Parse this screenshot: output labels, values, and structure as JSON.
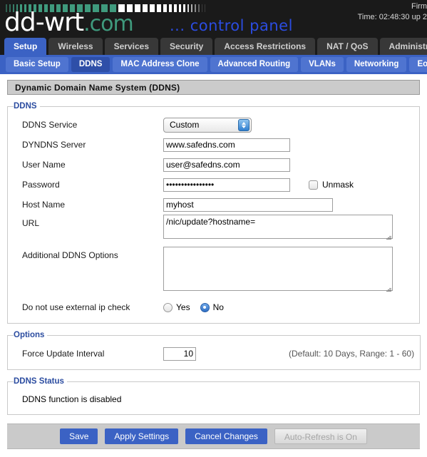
{
  "header": {
    "logo_main": "dd-wrt",
    "logo_suffix": ".com",
    "tagline": "... control panel",
    "firmware_line": "Firm",
    "time_line": "Time: 02:48:30 up 2",
    "barcode_colors": [
      "#3f9a7d",
      "#ffffff"
    ]
  },
  "nav": {
    "tabs": [
      {
        "label": "Setup",
        "active": true
      },
      {
        "label": "Wireless",
        "active": false
      },
      {
        "label": "Services",
        "active": false
      },
      {
        "label": "Security",
        "active": false
      },
      {
        "label": "Access Restrictions",
        "active": false
      },
      {
        "label": "NAT / QoS",
        "active": false
      },
      {
        "label": "Administration",
        "active": false
      }
    ],
    "subtabs": [
      {
        "label": "Basic Setup",
        "active": false
      },
      {
        "label": "DDNS",
        "active": true
      },
      {
        "label": "MAC Address Clone",
        "active": false
      },
      {
        "label": "Advanced Routing",
        "active": false
      },
      {
        "label": "VLANs",
        "active": false
      },
      {
        "label": "Networking",
        "active": false
      },
      {
        "label": "EoI",
        "active": false
      }
    ]
  },
  "page": {
    "title": "Dynamic Domain Name System (DDNS)"
  },
  "ddns": {
    "legend": "DDNS",
    "service_label": "DDNS Service",
    "service_value": "Custom",
    "server_label": "DYNDNS Server",
    "server_value": "www.safedns.com",
    "username_label": "User Name",
    "username_value": "user@safedns.com",
    "password_label": "Password",
    "password_value": "••••••••••••••••",
    "unmask_label": "Unmask",
    "unmask_checked": false,
    "hostname_label": "Host Name",
    "hostname_value": "myhost",
    "url_label": "URL",
    "url_value": "/nic/update?hostname=",
    "additional_label": "Additional DDNS Options",
    "additional_value": "",
    "external_ip_label": "Do not use external ip check",
    "external_ip_yes": "Yes",
    "external_ip_no": "No",
    "external_ip_selected": "No"
  },
  "options": {
    "legend": "Options",
    "force_update_label": "Force Update Interval",
    "force_update_value": "10",
    "force_update_hint": "(Default: 10 Days, Range: 1 - 60)"
  },
  "status": {
    "legend": "DDNS Status",
    "text": "DDNS function is disabled"
  },
  "footer": {
    "save": "Save",
    "apply": "Apply Settings",
    "cancel": "Cancel Changes",
    "autorefresh": "Auto-Refresh is On"
  }
}
